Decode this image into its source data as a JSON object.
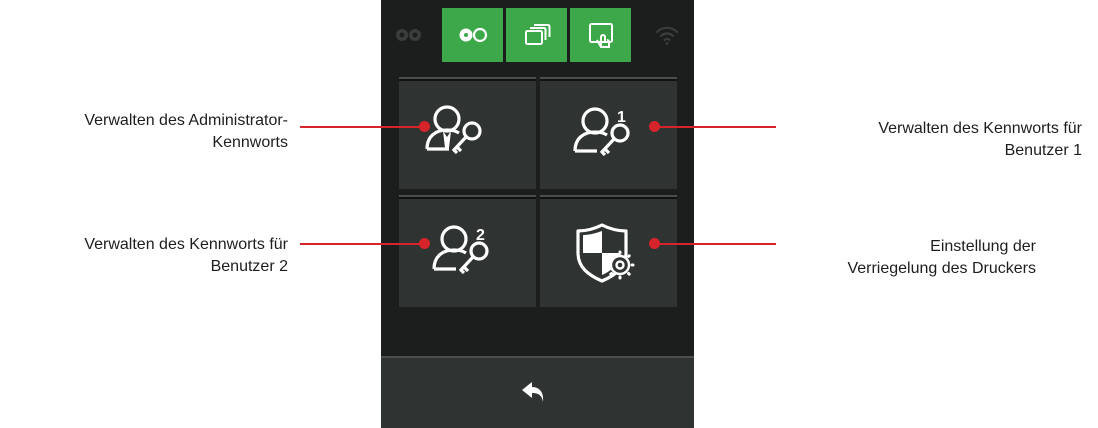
{
  "annotations": {
    "admin_password": [
      "Verwalten des Administrator-",
      "Kennworts"
    ],
    "user1_password": [
      "Verwalten des Kennworts für",
      "Benutzer 1"
    ],
    "user2_password": [
      "Verwalten des Kennworts für",
      "Benutzer 2"
    ],
    "printer_lock": [
      "Einstellung der",
      "Verriegelung des Druckers"
    ]
  },
  "topbar": {
    "icons": [
      "ribbon-cassette-icon",
      "ribbon-icon",
      "card-stack-icon",
      "touch-card-icon",
      "wifi-icon"
    ]
  },
  "tiles": [
    {
      "name": "admin-password-tile",
      "icon": "admin-key-icon"
    },
    {
      "name": "user1-password-tile",
      "icon": "user1-key-icon",
      "badge": "1"
    },
    {
      "name": "user2-password-tile",
      "icon": "user2-key-icon",
      "badge": "2"
    },
    {
      "name": "printer-lock-tile",
      "icon": "shield-gear-icon"
    }
  ],
  "colors": {
    "accent_green": "#3ca84a",
    "callout_red": "#d6242a",
    "panel_dark": "#1c1e1d",
    "tile": "#2f3331"
  }
}
